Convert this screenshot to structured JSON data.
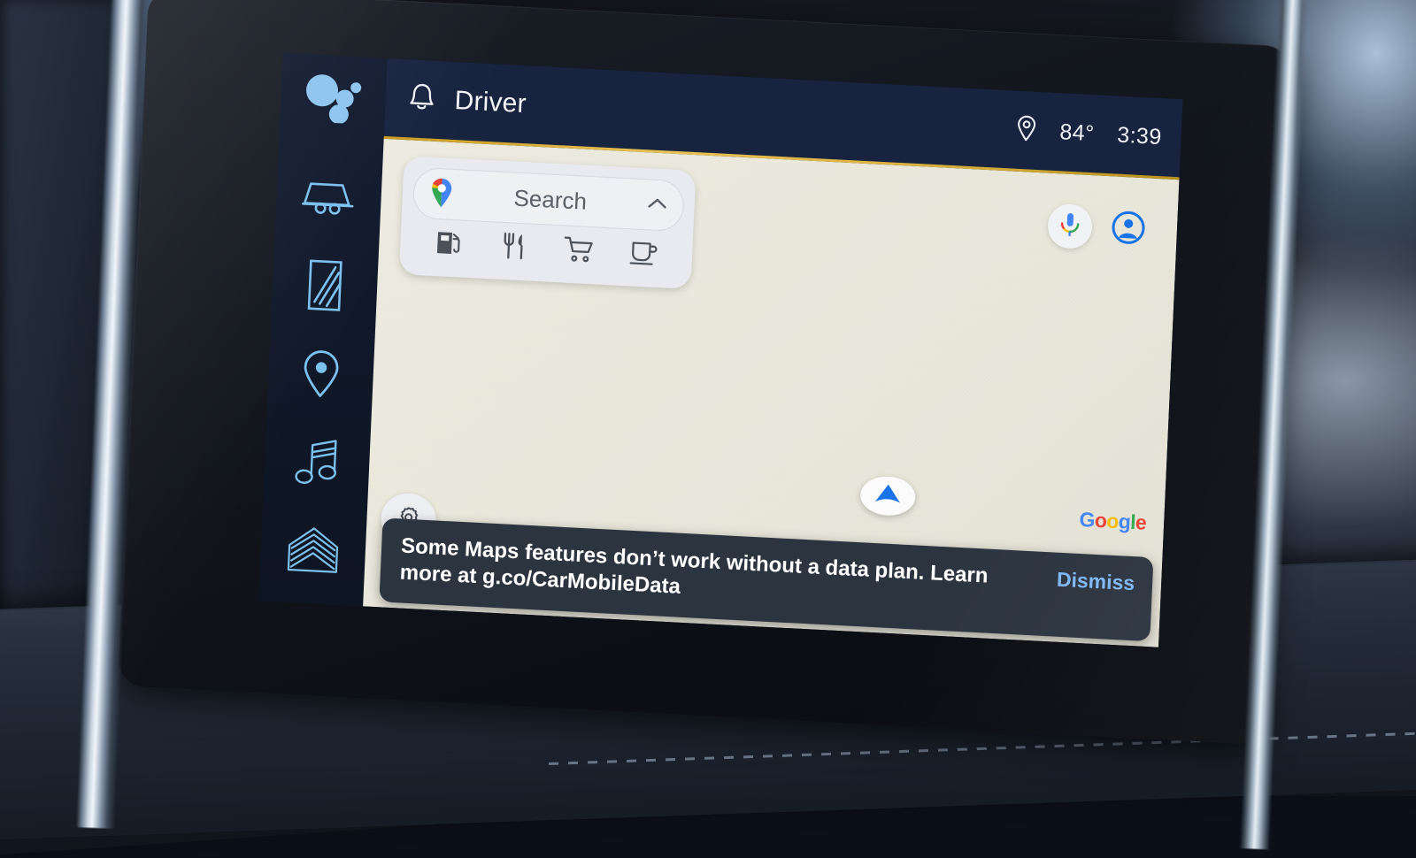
{
  "vehicle_hmi": {
    "brand_logo": "assistant-dots-logo",
    "header": {
      "notification_icon": "bell-icon",
      "title": "Driver",
      "status": {
        "location_icon": "location-pin-icon",
        "temperature": "84°",
        "time": "3:39"
      }
    },
    "accent_color": "#d8b03d",
    "rail": {
      "items": [
        {
          "icon": "vehicle-icon",
          "label": "Vehicle"
        },
        {
          "icon": "climate-icon",
          "label": "Climate"
        },
        {
          "icon": "navigation-pin-icon",
          "label": "Navigation"
        },
        {
          "icon": "music-note-icon",
          "label": "Media"
        },
        {
          "icon": "chevron-stack-icon",
          "label": "Apps"
        }
      ]
    }
  },
  "maps": {
    "surface_color": "#e8e6d9",
    "search": {
      "maps_pin_icon": "google-maps-pin-icon",
      "placeholder": "Search",
      "expand_icon": "chevron-up-icon",
      "categories": [
        {
          "icon": "gas-station-icon",
          "label": "Gas"
        },
        {
          "icon": "restaurant-icon",
          "label": "Food"
        },
        {
          "icon": "shopping-cart-icon",
          "label": "Groceries"
        },
        {
          "icon": "coffee-cup-icon",
          "label": "Coffee"
        }
      ]
    },
    "mic_icon": "microphone-icon",
    "account_icon": "account-circle-icon",
    "location_puck_icon": "navigation-arrow-icon",
    "settings_icon": "gear-icon",
    "watermark": {
      "text": "Google",
      "letters": [
        {
          "ch": "G",
          "color": "#4285F4"
        },
        {
          "ch": "o",
          "color": "#EA4335"
        },
        {
          "ch": "o",
          "color": "#FBBC05"
        },
        {
          "ch": "g",
          "color": "#4285F4"
        },
        {
          "ch": "l",
          "color": "#34A853"
        },
        {
          "ch": "e",
          "color": "#EA4335"
        }
      ]
    },
    "snackbar": {
      "message": "Some Maps features don’t work without a data plan. Learn more at g.co/CarMobileData",
      "action_label": "Dismiss",
      "action_color": "#7fb7f5"
    }
  }
}
